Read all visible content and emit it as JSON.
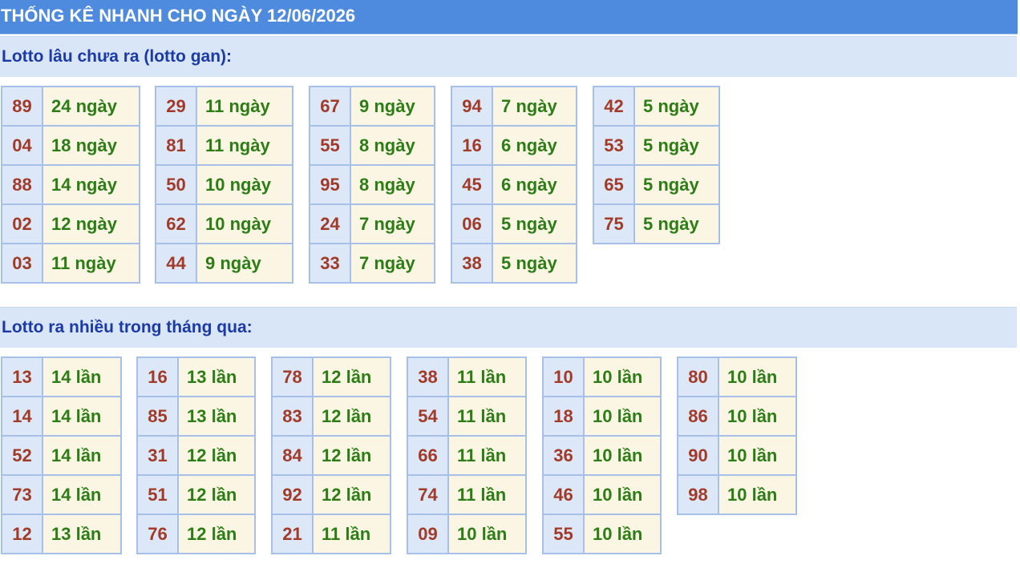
{
  "header": {
    "title": "THỐNG KÊ NHANH CHO NGÀY 12/06/2026"
  },
  "sections": [
    {
      "heading": "Lotto lâu chưa ra (lotto gan):",
      "groups": [
        {
          "rows": [
            {
              "number": "89",
              "value": "24 ngày"
            },
            {
              "number": "04",
              "value": "18 ngày"
            },
            {
              "number": "88",
              "value": "14 ngày"
            },
            {
              "number": "02",
              "value": "12 ngày"
            },
            {
              "number": "03",
              "value": "11 ngày"
            }
          ]
        },
        {
          "rows": [
            {
              "number": "29",
              "value": "11 ngày"
            },
            {
              "number": "81",
              "value": "11 ngày"
            },
            {
              "number": "50",
              "value": "10 ngày"
            },
            {
              "number": "62",
              "value": "10 ngày"
            },
            {
              "number": "44",
              "value": "9 ngày"
            }
          ]
        },
        {
          "rows": [
            {
              "number": "67",
              "value": "9 ngày"
            },
            {
              "number": "55",
              "value": "8 ngày"
            },
            {
              "number": "95",
              "value": "8 ngày"
            },
            {
              "number": "24",
              "value": "7 ngày"
            },
            {
              "number": "33",
              "value": "7 ngày"
            }
          ]
        },
        {
          "rows": [
            {
              "number": "94",
              "value": "7 ngày"
            },
            {
              "number": "16",
              "value": "6 ngày"
            },
            {
              "number": "45",
              "value": "6 ngày"
            },
            {
              "number": "06",
              "value": "5 ngày"
            },
            {
              "number": "38",
              "value": "5 ngày"
            }
          ]
        },
        {
          "rows": [
            {
              "number": "42",
              "value": "5 ngày"
            },
            {
              "number": "53",
              "value": "5 ngày"
            },
            {
              "number": "65",
              "value": "5 ngày"
            },
            {
              "number": "75",
              "value": "5 ngày"
            }
          ]
        }
      ]
    },
    {
      "heading": "Lotto ra nhiều trong tháng qua:",
      "groups": [
        {
          "rows": [
            {
              "number": "13",
              "value": "14 lần"
            },
            {
              "number": "14",
              "value": "14 lần"
            },
            {
              "number": "52",
              "value": "14 lần"
            },
            {
              "number": "73",
              "value": "14 lần"
            },
            {
              "number": "12",
              "value": "13 lần"
            }
          ]
        },
        {
          "rows": [
            {
              "number": "16",
              "value": "13 lần"
            },
            {
              "number": "85",
              "value": "13 lần"
            },
            {
              "number": "31",
              "value": "12 lần"
            },
            {
              "number": "51",
              "value": "12 lần"
            },
            {
              "number": "76",
              "value": "12 lần"
            }
          ]
        },
        {
          "rows": [
            {
              "number": "78",
              "value": "12 lần"
            },
            {
              "number": "83",
              "value": "12 lần"
            },
            {
              "number": "84",
              "value": "12 lần"
            },
            {
              "number": "92",
              "value": "12 lần"
            },
            {
              "number": "21",
              "value": "11 lần"
            }
          ]
        },
        {
          "rows": [
            {
              "number": "38",
              "value": "11 lần"
            },
            {
              "number": "54",
              "value": "11 lần"
            },
            {
              "number": "66",
              "value": "11 lần"
            },
            {
              "number": "74",
              "value": "11 lần"
            },
            {
              "number": "09",
              "value": "10 lần"
            }
          ]
        },
        {
          "rows": [
            {
              "number": "10",
              "value": "10 lần"
            },
            {
              "number": "18",
              "value": "10 lần"
            },
            {
              "number": "36",
              "value": "10 lần"
            },
            {
              "number": "46",
              "value": "10 lần"
            },
            {
              "number": "55",
              "value": "10 lần"
            }
          ]
        },
        {
          "rows": [
            {
              "number": "80",
              "value": "10 lần"
            },
            {
              "number": "86",
              "value": "10 lần"
            },
            {
              "number": "90",
              "value": "10 lần"
            },
            {
              "number": "98",
              "value": "10 lần"
            }
          ]
        }
      ]
    }
  ]
}
